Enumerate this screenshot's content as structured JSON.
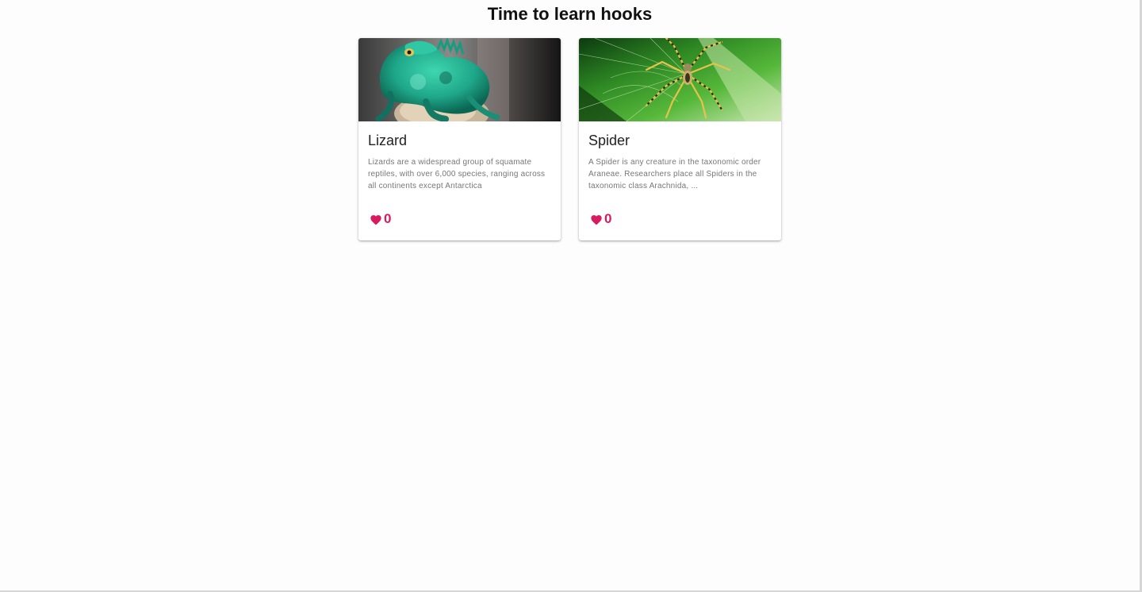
{
  "page": {
    "title": "Time to learn hooks"
  },
  "cards": [
    {
      "title": "Lizard",
      "description": "Lizards are a widespread group of squamate reptiles, with over 6,000 species, ranging across all continents except Antarctica",
      "likes": "0",
      "image_subject": "lizard",
      "like_icon": "heart-icon"
    },
    {
      "title": "Spider",
      "description": "A Spider is any creature in the taxonomic order Araneae. Researchers place all Spiders in the taxonomic class Arachnida, ...",
      "likes": "0",
      "image_subject": "spider",
      "like_icon": "heart-icon"
    }
  ],
  "colors": {
    "accent": "#d81b60",
    "title_text": "#111111",
    "card_background": "#ffffff",
    "page_background": "#fdfdfd"
  }
}
